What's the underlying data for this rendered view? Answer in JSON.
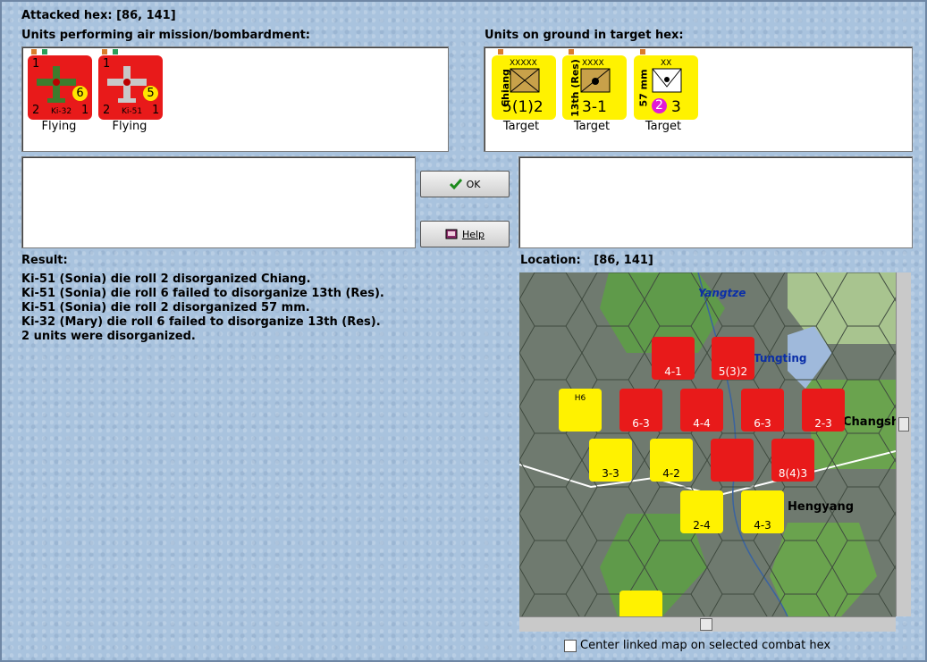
{
  "header": {
    "attacked_hex": "Attacked hex:  [86, 141]"
  },
  "air_panel": {
    "title": "Units performing air mission/bombardment:",
    "units": [
      {
        "top_left": "1",
        "model": "Ki-32",
        "rating": "6",
        "bottom_left": "2",
        "bottom_right": "1",
        "status": "Flying",
        "color": "#e81a1a"
      },
      {
        "top_left": "1",
        "model": "Ki-51",
        "rating": "5",
        "bottom_left": "2",
        "bottom_right": "1",
        "status": "Flying",
        "color": "#e81a1a"
      }
    ]
  },
  "ground_panel": {
    "title": "Units on ground in target hex:",
    "units": [
      {
        "name": "Chiang",
        "size": "XXXXX",
        "strength": "5(1)2",
        "status": "Target",
        "type": "infantry-icon",
        "color": "#fff200"
      },
      {
        "name": "13th (Res)",
        "size": "XXXX",
        "strength": "3-1",
        "status": "Target",
        "type": "artillery-icon",
        "color": "#fff200"
      },
      {
        "name": "57 mm",
        "size": "XX",
        "strength_badge": "2",
        "strength": "3",
        "status": "Target",
        "type": "antitank-icon",
        "color": "#fff200"
      }
    ]
  },
  "buttons": {
    "ok": "OK",
    "help": "Help"
  },
  "result": {
    "label": "Result:",
    "lines": [
      "Ki-51 (Sonia) die roll 2 disorganized Chiang.",
      "Ki-51 (Sonia) die roll 6 failed to disorganize 13th (Res).",
      "Ki-51 (Sonia) die roll 2 disorganized 57 mm.",
      "Ki-32 (Mary) die roll 6 failed to disorganize 13th (Res).",
      "2 units were disorganized."
    ]
  },
  "location": {
    "label": "Location:",
    "value": "[86, 141]"
  },
  "map": {
    "labels": [
      "Yangtze",
      "Tungting",
      "Changsha",
      "Hengyang"
    ],
    "units": [
      {
        "label": "4-1",
        "color": "#e81a1a"
      },
      {
        "label": "5(3)2",
        "color": "#e81a1a"
      },
      {
        "label": "6-3",
        "color": "#e81a1a"
      },
      {
        "label": "4-4",
        "color": "#e81a1a"
      },
      {
        "label": "6-3",
        "color": "#e81a1a"
      },
      {
        "label": "2-3",
        "color": "#e81a1a"
      },
      {
        "label": "3-3",
        "color": "#fff200"
      },
      {
        "label": "4-2",
        "color": "#fff200"
      },
      {
        "label": "8(4)3",
        "color": "#e81a1a"
      },
      {
        "label": "2-4",
        "color": "#fff200"
      },
      {
        "label": "4-3",
        "color": "#fff200"
      },
      {
        "label": "H6",
        "color": "#fff200"
      }
    ]
  },
  "footer": {
    "center_checkbox": "Center linked map on selected combat hex",
    "center_checked": false
  }
}
